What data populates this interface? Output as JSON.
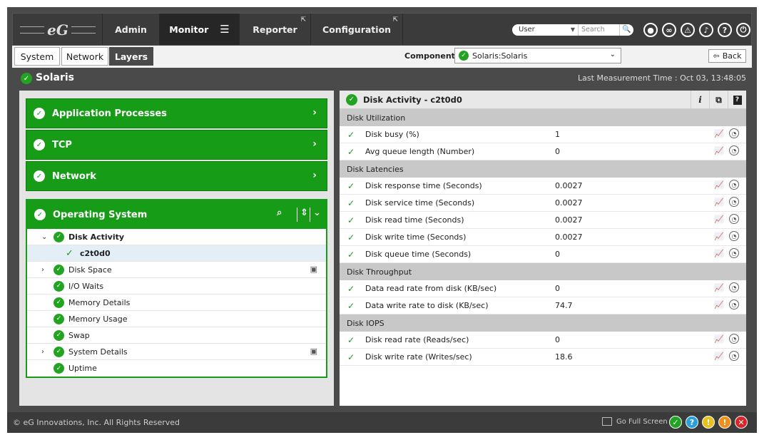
{
  "logo": {
    "text": "eG"
  },
  "nav": {
    "tabs": [
      {
        "label": "Admin"
      },
      {
        "label": "Monitor"
      },
      {
        "label": "Reporter"
      },
      {
        "label": "Configuration"
      }
    ],
    "user_select": "User",
    "search_placeholder": "Search"
  },
  "subtabs": [
    {
      "label": "System"
    },
    {
      "label": "Network"
    },
    {
      "label": "Layers"
    }
  ],
  "component": {
    "label": "Component",
    "value": "Solaris:Solaris"
  },
  "back_label": "Back",
  "system_name": "Solaris",
  "last_measurement": "Last Measurement Time : Oct 03, 13:48:05",
  "layers": [
    {
      "label": "Application Processes"
    },
    {
      "label": "TCP"
    },
    {
      "label": "Network"
    }
  ],
  "os_layer": {
    "label": "Operating System",
    "tree": [
      {
        "label": "Disk Activity"
      },
      {
        "label": "c2t0d0"
      },
      {
        "label": "Disk Space"
      },
      {
        "label": "I/O Waits"
      },
      {
        "label": "Memory Details"
      },
      {
        "label": "Memory Usage"
      },
      {
        "label": "Swap"
      },
      {
        "label": "System Details"
      },
      {
        "label": "Uptime"
      }
    ]
  },
  "details": {
    "title": "Disk Activity - c2t0d0",
    "groups": [
      {
        "name": "Disk Utilization",
        "rows": [
          {
            "name": "Disk busy (%)",
            "value": "1"
          },
          {
            "name": "Avg queue length (Number)",
            "value": "0"
          }
        ]
      },
      {
        "name": "Disk Latencies",
        "rows": [
          {
            "name": "Disk response time (Seconds)",
            "value": "0.0027"
          },
          {
            "name": "Disk service time (Seconds)",
            "value": "0.0027"
          },
          {
            "name": "Disk read time (Seconds)",
            "value": "0.0027"
          },
          {
            "name": "Disk write time (Seconds)",
            "value": "0.0027"
          },
          {
            "name": "Disk queue time (Seconds)",
            "value": "0"
          }
        ]
      },
      {
        "name": "Disk Throughput",
        "rows": [
          {
            "name": "Data read rate from disk (KB/sec)",
            "value": "0"
          },
          {
            "name": "Data write rate to disk (KB/sec)",
            "value": "74.7"
          }
        ]
      },
      {
        "name": "Disk IOPS",
        "rows": [
          {
            "name": "Disk read rate (Reads/sec)",
            "value": "0"
          },
          {
            "name": "Disk write rate (Writes/sec)",
            "value": "18.6"
          }
        ]
      }
    ]
  },
  "footer": {
    "copyright": "© eG Innovations, Inc. All Rights Reserved",
    "fullscreen_label": "Go Full Screen"
  },
  "colors": {
    "green": "#169c16",
    "status_blue": "#2aa0d8",
    "status_yellow": "#e8c020",
    "status_orange": "#f0901c",
    "status_red": "#d8262a"
  }
}
